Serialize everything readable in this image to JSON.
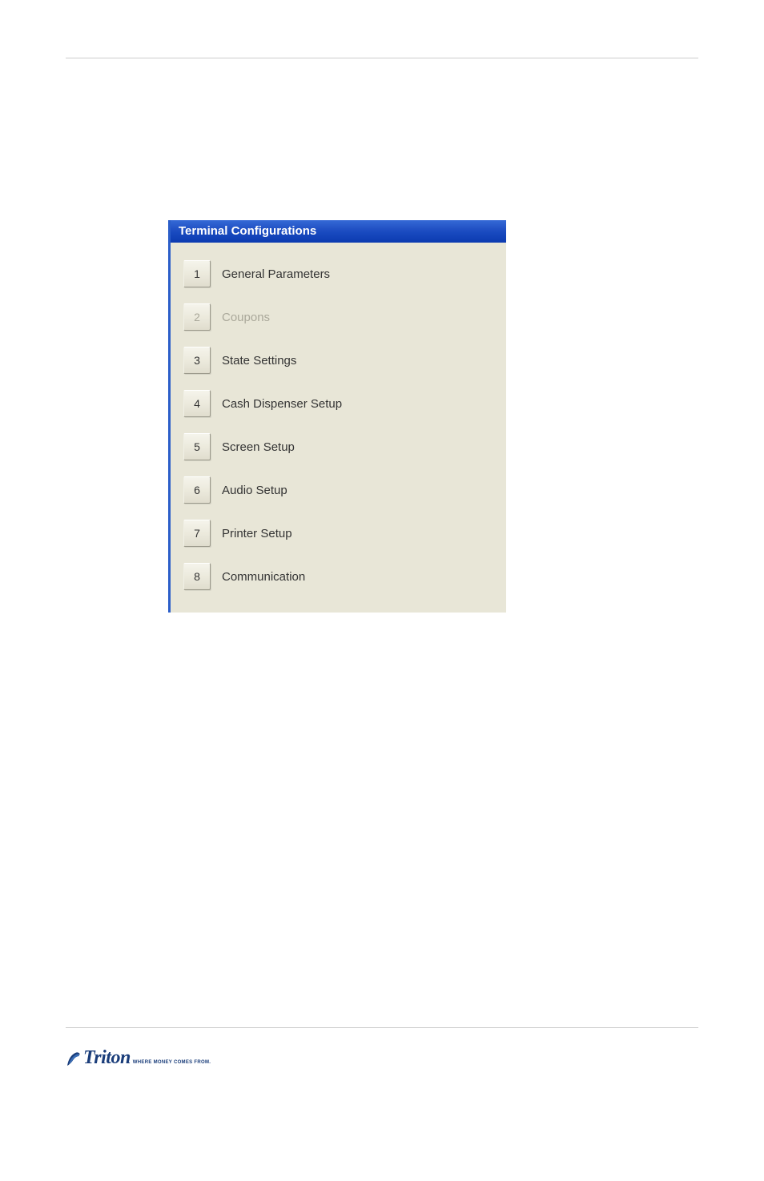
{
  "window": {
    "title": "Terminal Configurations",
    "items": [
      {
        "num": "1",
        "label": "General Parameters",
        "enabled": true
      },
      {
        "num": "2",
        "label": "Coupons",
        "enabled": false
      },
      {
        "num": "3",
        "label": "State Settings",
        "enabled": true
      },
      {
        "num": "4",
        "label": "Cash Dispenser Setup",
        "enabled": true
      },
      {
        "num": "5",
        "label": "Screen Setup",
        "enabled": true
      },
      {
        "num": "6",
        "label": "Audio Setup",
        "enabled": true
      },
      {
        "num": "7",
        "label": "Printer Setup",
        "enabled": true
      },
      {
        "num": "8",
        "label": "Communication",
        "enabled": true
      }
    ]
  },
  "branding": {
    "name": "Triton",
    "tagline": "WHERE MONEY COMES FROM."
  }
}
